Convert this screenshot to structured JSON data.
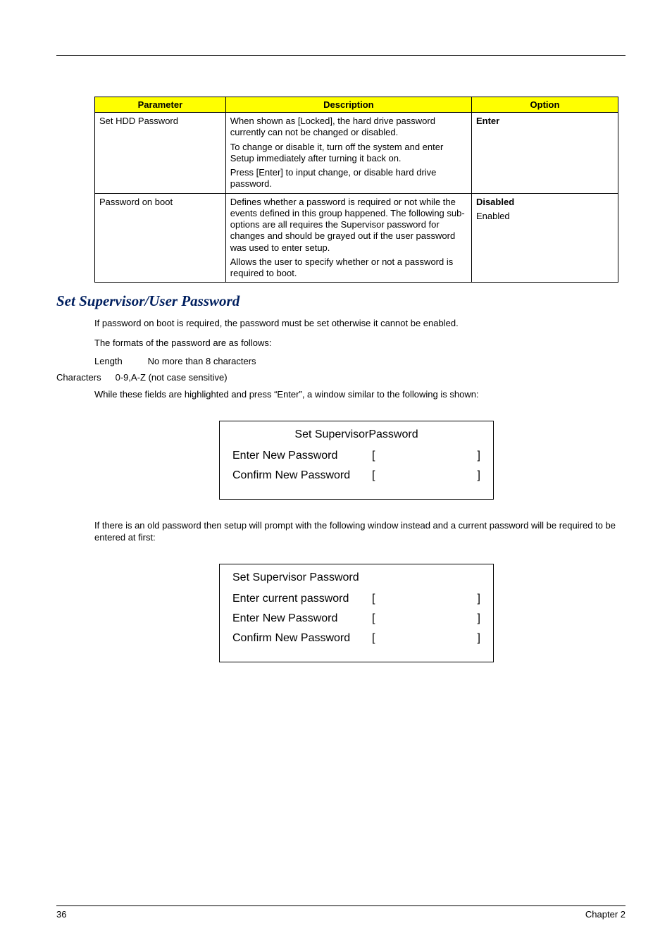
{
  "table": {
    "headers": [
      "Parameter",
      "Description",
      "Option"
    ],
    "rows": [
      {
        "param": "Set HDD Password",
        "desc_p1": "When shown as [Locked], the hard drive password currently can not be changed or disabled.",
        "desc_p2": "To change or disable it, turn off the system and enter Setup immediately after turning it back on.",
        "desc_p3": "Press [Enter] to input change, or disable hard drive password.",
        "option1": "Enter",
        "option2": ""
      },
      {
        "param": "Password on boot",
        "desc_p1": "Defines whether a password is required or not while the events defined in this group happened. The following sub-options are all requires the Supervisor password for changes and should be grayed out if the user password was used to enter setup.",
        "desc_p2": "Allows the user to specify whether or not a password is required to boot.",
        "desc_p3": "",
        "option1": "Disabled",
        "option2": "Enabled"
      }
    ]
  },
  "section_heading": "Set Supervisor/User Password",
  "para1": "If password on boot is required, the password must be set otherwise it cannot be enabled.",
  "para2": "The formats of the password are as follows:",
  "length_label": "Length",
  "length_value": "No more than 8 characters",
  "chars_label": "Characters",
  "chars_value": "0-9,A-Z (not case sensitive)",
  "para3": "While these fields are highlighted and press “Enter”,  a window similar to the following is shown:",
  "dialog1": {
    "title": "Set SupervisorPassword",
    "row1": "Enter New Password",
    "row2": "Confirm New Password"
  },
  "para4": "If there is an old password then setup will prompt with the following window instead and a current password will be required to be entered at first:",
  "dialog2": {
    "title": "Set Supervisor Password",
    "row1": "Enter current password",
    "row2": "Enter New Password",
    "row3": "Confirm New Password"
  },
  "bracket_open": "[",
  "bracket_close": "]",
  "footer_left": "36",
  "footer_right": "Chapter 2"
}
